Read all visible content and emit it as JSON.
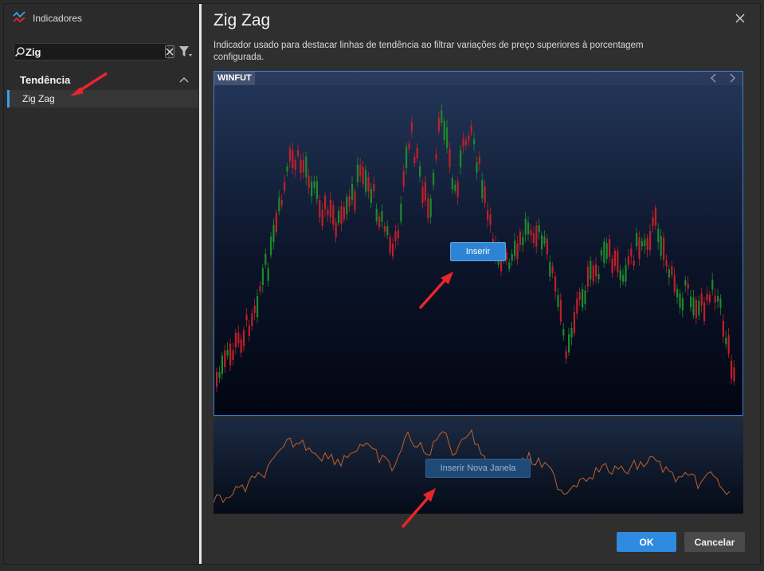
{
  "window": {
    "title": "Indicadores",
    "icon": "indicator-chart-icon"
  },
  "sidebar": {
    "search": {
      "value": "Zig",
      "placeholder": ""
    },
    "sections": [
      {
        "label": "Tendência",
        "expanded": true,
        "items": [
          {
            "label": "Zig Zag",
            "selected": true
          }
        ]
      }
    ]
  },
  "main": {
    "title": "Zig Zag",
    "description": "Indicador usado para destacar linhas de tendência ao filtrar variações de preço superiores à porcentagem configurada.",
    "preview": {
      "symbol": "WINFUT",
      "insert_label": "Inserir",
      "insert_new_window_label": "Inserir Nova Janela"
    }
  },
  "footer": {
    "ok_label": "OK",
    "cancel_label": "Cancelar"
  },
  "colors": {
    "accent": "#2f8be0",
    "candle_up": "#1f8a2a",
    "candle_down": "#c0202a",
    "zigzag_line": "#c0602a",
    "annotation_arrow": "#e8262a"
  }
}
